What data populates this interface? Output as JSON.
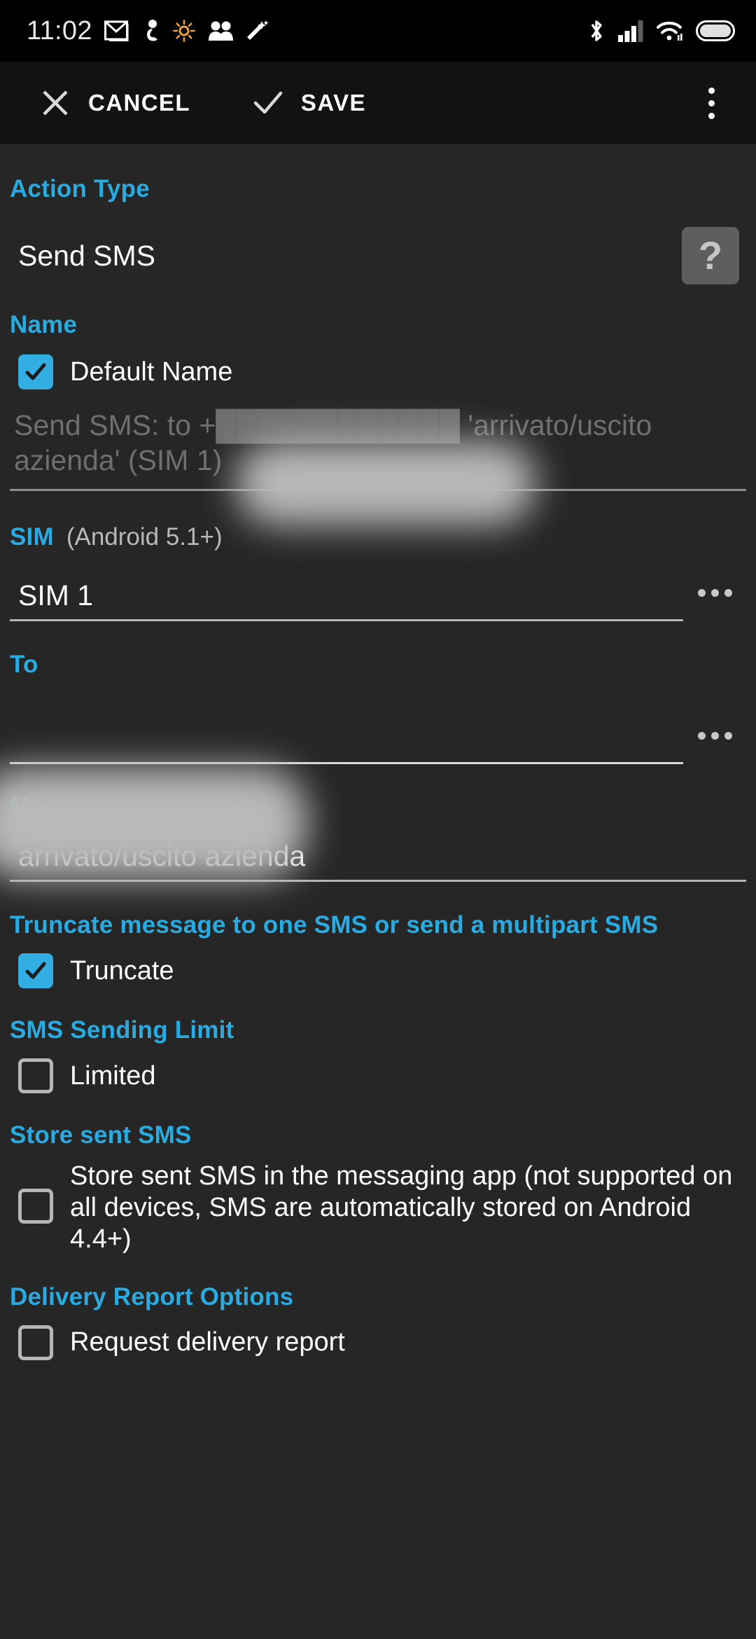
{
  "statusbar": {
    "time": "11:02",
    "left_icons": [
      "gmail-icon",
      "person-icon",
      "brightness-icon",
      "people-icon",
      "magic-wand-icon"
    ],
    "right_icons": [
      "bluetooth-icon",
      "cellular-signal-icon",
      "wifi-icon",
      "battery-icon"
    ]
  },
  "actionbar": {
    "cancel_label": "CANCEL",
    "save_label": "SAVE",
    "overflow_name": "more-options-icon"
  },
  "action_type": {
    "label": "Action Type",
    "value": "Send SMS",
    "help_glyph": "?"
  },
  "name": {
    "label": "Name",
    "checkbox_label": "Default Name",
    "checked": true,
    "preview": "Send SMS: to +████████████ 'arrivato/uscito azienda' (SIM 1)"
  },
  "sim": {
    "label": "SIM",
    "sublabel": "(Android 5.1+)",
    "value": "SIM 1",
    "more_name": "sim-more-button"
  },
  "to": {
    "label": "To",
    "value": "",
    "more_name": "to-more-button"
  },
  "message": {
    "label": "Message",
    "value": "arrivato/uscito azienda"
  },
  "truncate": {
    "label": "Truncate message to one SMS or send a multipart SMS",
    "checkbox_label": "Truncate",
    "checked": true
  },
  "sending_limit": {
    "label": "SMS Sending Limit",
    "checkbox_label": "Limited",
    "checked": false
  },
  "store_sent": {
    "label": "Store sent SMS",
    "checkbox_label": "Store sent SMS in the messaging app (not supported on all devices, SMS are automatically stored on Android 4.4+)",
    "checked": false
  },
  "delivery_report": {
    "label": "Delivery Report Options",
    "checkbox_label": "Request delivery report",
    "checked": false
  },
  "colors": {
    "accent_blue": "#29abe2",
    "checkbox_blue": "#32aee3",
    "background": "#262626",
    "actionbar_bg": "#121212",
    "statusbar_bg": "#000000",
    "muted_text": "#6f6f6f",
    "divider": "#b5b5b5"
  }
}
